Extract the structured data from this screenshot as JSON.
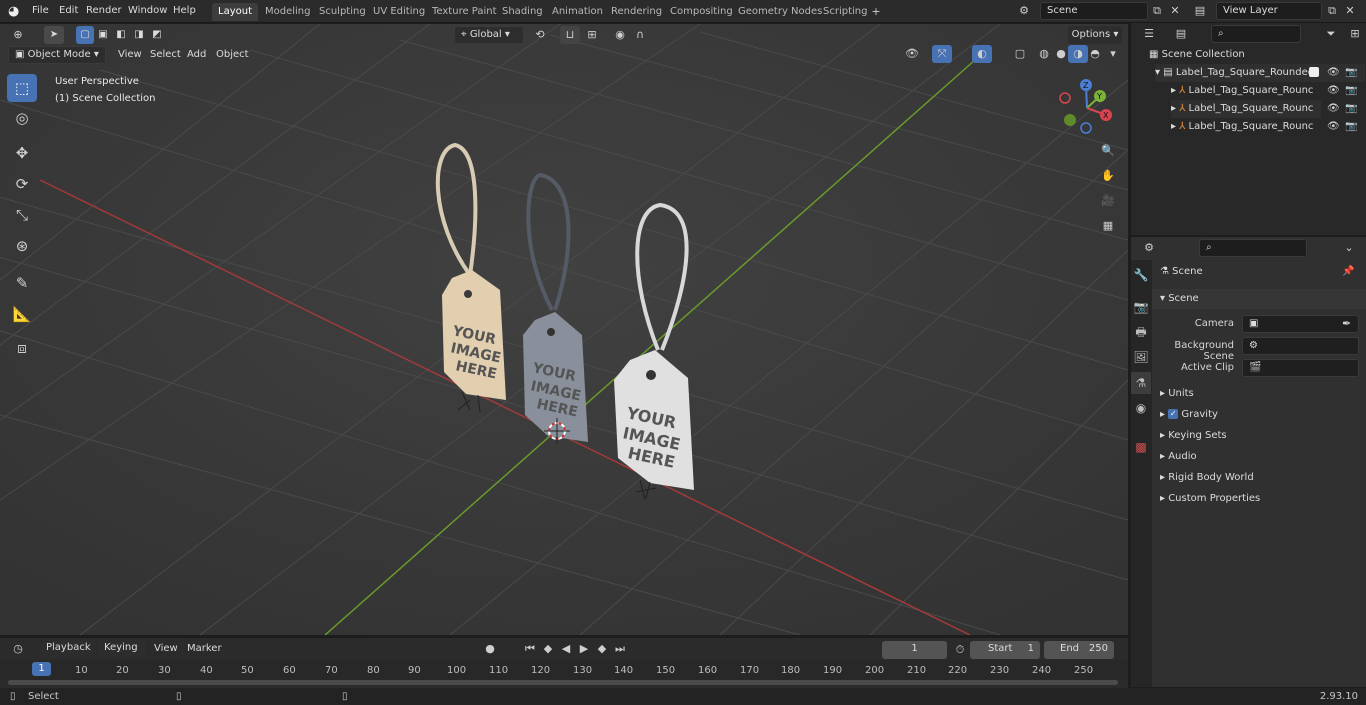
{
  "menu": {
    "logo": "blender-logo-icon",
    "items": [
      "File",
      "Edit",
      "Render",
      "Window",
      "Help"
    ]
  },
  "workspaces": [
    "Layout",
    "Modeling",
    "Sculpting",
    "UV Editing",
    "Texture Paint",
    "Shading",
    "Animation",
    "Rendering",
    "Compositing",
    "Geometry Nodes",
    "Scripting"
  ],
  "active_workspace": "Layout",
  "topright": {
    "scene": "Scene",
    "view_layer": "View Layer"
  },
  "viewport": {
    "mode": "Object Mode",
    "menus": [
      "View",
      "Select",
      "Add",
      "Object"
    ],
    "orientation": "Global",
    "options": "Options",
    "overlay_line1": "User Perspective",
    "overlay_line2": "(1) Scene Collection",
    "tag_text": [
      "YOUR",
      "IMAGE",
      "HERE"
    ],
    "gizmo": {
      "z": "Z",
      "y": "Y",
      "x": "X"
    }
  },
  "outliner": {
    "root": "Scene Collection",
    "collection": "Label_Tag_Square_Rounded",
    "children": [
      "Label_Tag_Square_Rounc",
      "Label_Tag_Square_Rounc",
      "Label_Tag_Square_Rounc"
    ]
  },
  "properties": {
    "header": "Scene",
    "section": "Scene",
    "camera_label": "Camera",
    "background_scene_label": "Background Scene",
    "active_clip_label": "Active Clip",
    "panels": [
      "Units",
      "Gravity",
      "Keying Sets",
      "Audio",
      "Rigid Body World",
      "Custom Properties"
    ],
    "gravity_checked": true
  },
  "timeline": {
    "menus": [
      "Playback",
      "Keying",
      "View",
      "Marker"
    ],
    "current_frame": "1",
    "start_label": "Start",
    "start": "1",
    "end_label": "End",
    "end": "250",
    "ticks": [
      "1",
      "10",
      "20",
      "30",
      "40",
      "50",
      "60",
      "70",
      "80",
      "90",
      "100",
      "110",
      "120",
      "130",
      "140",
      "150",
      "160",
      "170",
      "180",
      "190",
      "200",
      "210",
      "220",
      "230",
      "240",
      "250"
    ]
  },
  "status": {
    "left": "Select",
    "version": "2.93.10"
  },
  "colors": {
    "accent": "#4772b3",
    "x_axis": "#a33a3a",
    "y_axis": "#6a9a2a"
  }
}
